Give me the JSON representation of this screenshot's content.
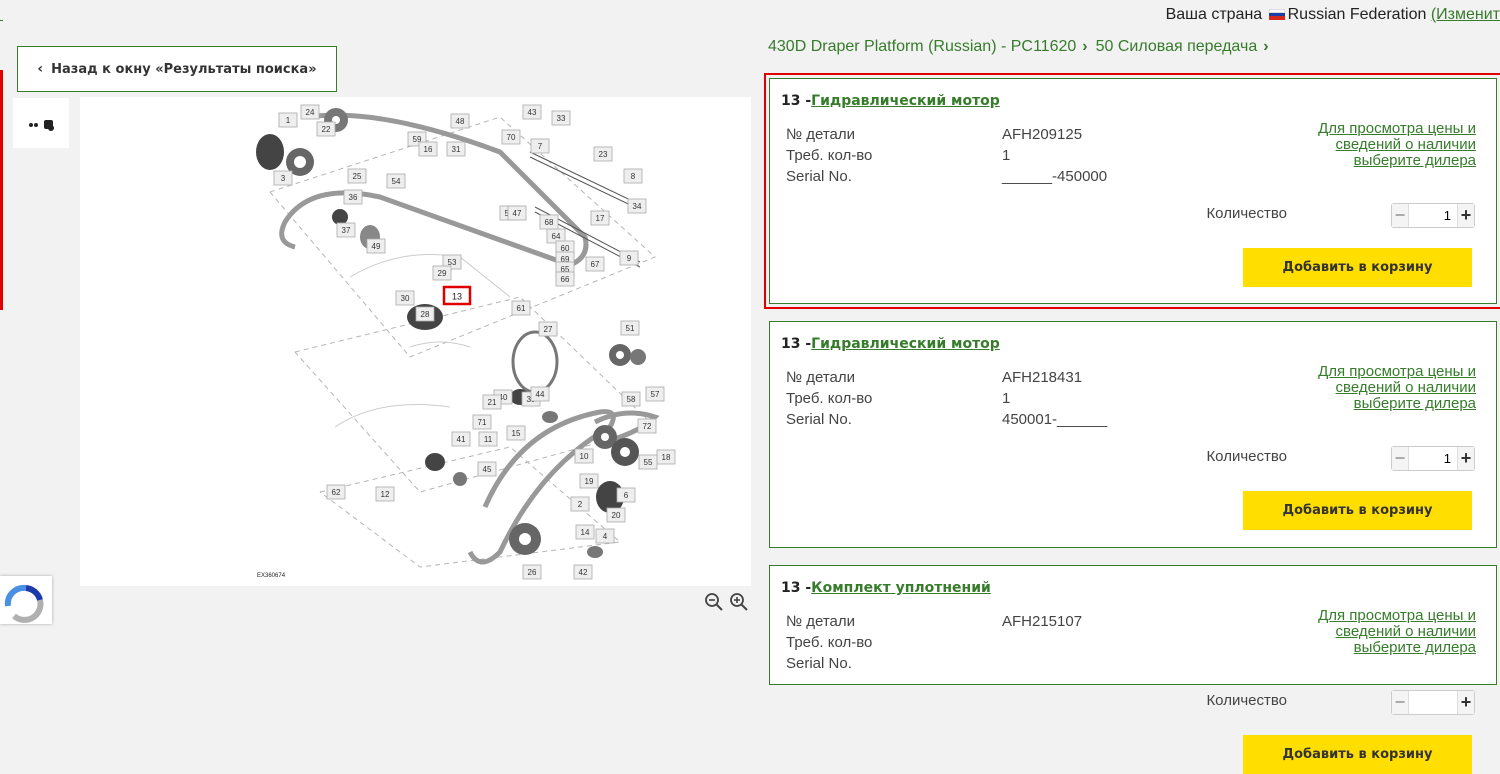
{
  "header": {
    "country_label": "Ваша страна",
    "country_name": "Russian Federation",
    "change_link": "(Изменит",
    "flag_colors": [
      "#ffffff",
      "#1c3fa8",
      "#d52b1e"
    ]
  },
  "back_button": {
    "label": "Назад к окну «Результаты поиска»",
    "icon": "chevron-left-icon"
  },
  "breadcrumbs": [
    {
      "label": "430D Draper Platform (Russian) - PC11620"
    },
    {
      "label": "50 Силовая передача"
    }
  ],
  "diagram": {
    "code": "EX360674",
    "highlight_callout": "13",
    "callouts": [
      "1",
      "24",
      "22",
      "3",
      "25",
      "54",
      "36",
      "37",
      "49",
      "53",
      "48",
      "59",
      "16",
      "17",
      "9",
      "23",
      "8",
      "50",
      "34",
      "47",
      "64",
      "60",
      "69",
      "65",
      "66",
      "67",
      "68",
      "70",
      "7",
      "43",
      "33",
      "31",
      "29",
      "30",
      "28",
      "61",
      "27",
      "51",
      "58",
      "57",
      "62",
      "12",
      "14",
      "20",
      "2",
      "42",
      "72",
      "41",
      "71",
      "40",
      "39",
      "44",
      "45",
      "21",
      "26",
      "19",
      "18",
      "10",
      "11",
      "15",
      "4",
      "6",
      "55"
    ]
  },
  "zoom": {
    "out_icon": "zoom-out-icon",
    "in_icon": "zoom-in-icon"
  },
  "labels": {
    "part_no": "№ детали",
    "req_qty": "Треб. кол-во",
    "serial": "Serial No.",
    "dealer_note": "Для просмотра цены и сведений о наличии выберите дилера",
    "quantity": "Количество",
    "add_to_cart": "Добавить в корзину"
  },
  "parts": [
    {
      "num": "13 -",
      "name": "Гидравлический мотор",
      "part_no": "AFH209125",
      "req_qty": "1",
      "serial": "______-450000",
      "quantity": "1",
      "selected": true
    },
    {
      "num": "13 -",
      "name": "Гидравлический мотор",
      "part_no": "AFH218431",
      "req_qty": "1",
      "serial": "450001-______",
      "quantity": "1",
      "selected": false
    },
    {
      "num": "13 -",
      "name": "Комплект уплотнений",
      "part_no": "AFH215107",
      "req_qty": "",
      "serial": "",
      "quantity": "",
      "selected": false
    }
  ],
  "colors": {
    "accent_green": "#367c2b",
    "button_yellow": "#ffde00",
    "highlight_red": "#e00000"
  }
}
